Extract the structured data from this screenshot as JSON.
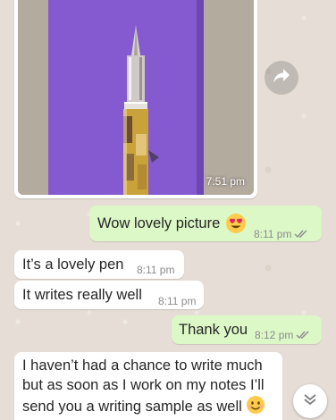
{
  "messages": {
    "image_time": "7:51 pm",
    "m1": {
      "text": "Wow lovely picture",
      "emoji": "heart-eyes-emoji",
      "time": "8:11 pm"
    },
    "m2": {
      "text": "It’s a lovely pen",
      "time": "8:11 pm"
    },
    "m3": {
      "text": "It writes really well",
      "time": "8:11 pm"
    },
    "m4": {
      "text": "Thank you",
      "time": "8:12 pm"
    },
    "m5": {
      "text": "I haven’t had a chance to write much but as soon as I work on my notes I’ll send you a writing sample as well"
    }
  },
  "colors": {
    "outgoing_bubble": "#dcf8c6",
    "incoming_bubble": "#ffffff",
    "read_ticks": "#8c8c8c",
    "pen_barrel": "#c9a23a"
  },
  "icons": {
    "share": "forward-arrow-icon",
    "scroll_down": "double-chevron-down-icon",
    "read_receipt": "double-check-icon"
  }
}
